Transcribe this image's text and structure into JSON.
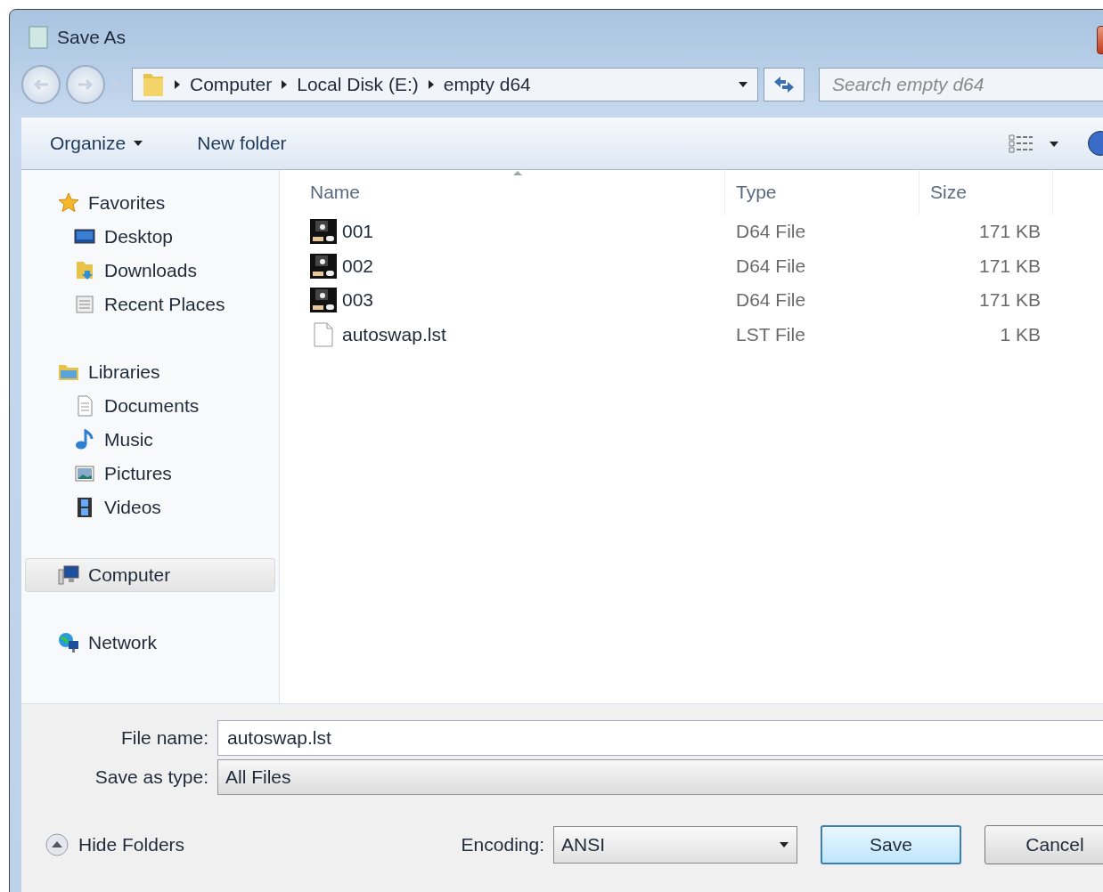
{
  "window": {
    "title": "Save As"
  },
  "address_bar": {
    "path": [
      "Computer",
      "Local Disk (E:)",
      "empty d64"
    ]
  },
  "search": {
    "placeholder": "Search empty d64"
  },
  "toolbar": {
    "buttons": [
      {
        "label": "Organize",
        "kind": "menu"
      },
      {
        "label": "New folder",
        "kind": "plain"
      }
    ]
  },
  "sidebar": {
    "groups": [
      {
        "label": "Favorites",
        "selected": false,
        "children": [
          {
            "label": "Desktop",
            "selected": false
          },
          {
            "label": "Downloads",
            "selected": false
          },
          {
            "label": "Recent Places",
            "selected": false
          }
        ]
      },
      {
        "label": "Libraries",
        "selected": false,
        "children": [
          {
            "label": "Documents",
            "selected": false
          },
          {
            "label": "Music",
            "selected": false
          },
          {
            "label": "Pictures",
            "selected": false
          },
          {
            "label": "Videos",
            "selected": false
          }
        ]
      },
      {
        "label": "Computer",
        "selected": true
      },
      {
        "label": "Network",
        "selected": false
      }
    ]
  },
  "file_list": {
    "columns": [
      {
        "label": "Name",
        "sorted": true
      },
      {
        "label": "Type",
        "sorted": false
      },
      {
        "label": "Size",
        "sorted": false
      }
    ],
    "rows": [
      {
        "name": "001",
        "type": "D64 File",
        "size": "171 KB",
        "kind": "disk",
        "selected": false
      },
      {
        "name": "002",
        "type": "D64 File",
        "size": "171 KB",
        "kind": "disk",
        "selected": false
      },
      {
        "name": "003",
        "type": "D64 File",
        "size": "171 KB",
        "kind": "disk",
        "selected": false
      },
      {
        "name": "autoswap.lst",
        "type": "LST File",
        "size": "1 KB",
        "kind": "document",
        "selected": false
      }
    ]
  },
  "form": {
    "file_name": {
      "label": "File name:",
      "value": "autoswap.lst"
    },
    "save_as_type": {
      "label": "Save as type:",
      "value": "All Files"
    },
    "encoding": {
      "label": "Encoding:",
      "value": "ANSI"
    }
  },
  "hide_folders": "Hide Folders",
  "buttons": [
    {
      "label": "Save",
      "default": true
    },
    {
      "label": "Cancel",
      "default": false
    }
  ]
}
